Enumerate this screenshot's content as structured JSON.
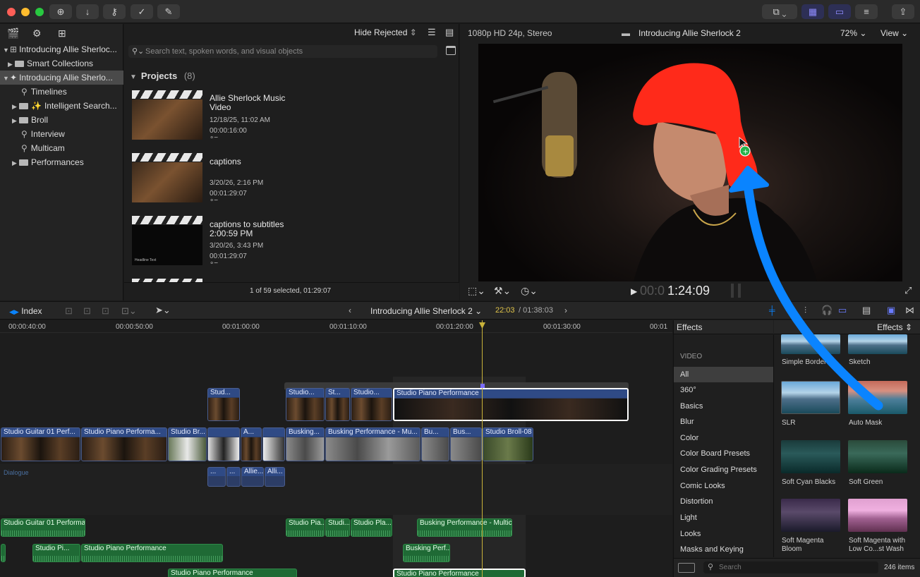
{
  "titlebar": {
    "buttons": [
      "plus-circle-icon",
      "download-icon",
      "key-icon",
      "check-circle-icon",
      "edit-icon"
    ]
  },
  "libraries": {
    "items": [
      {
        "label": "Introducing Allie Sherloc...",
        "depth": 0,
        "expanded": true
      },
      {
        "label": "Smart Collections",
        "depth": 1,
        "expanded": false
      },
      {
        "label": "Introducing Allie Sherlo...",
        "depth": 0,
        "expanded": true,
        "selected": true
      },
      {
        "label": "Timelines",
        "depth": 2,
        "kind": "smart"
      },
      {
        "label": "Intelligent Search...",
        "depth": 1,
        "expanded": false,
        "kind": "sparkle"
      },
      {
        "label": "Broll",
        "depth": 1,
        "expanded": false
      },
      {
        "label": "Interview",
        "depth": 2,
        "kind": "smart"
      },
      {
        "label": "Multicam",
        "depth": 2,
        "kind": "smart"
      },
      {
        "label": "Performances",
        "depth": 1,
        "expanded": false
      }
    ]
  },
  "browser": {
    "filter_label": "Hide Rejected",
    "search_placeholder": "Search text, spoken words, and visual objects",
    "section_title": "Projects",
    "section_count": "(8)",
    "projects": [
      {
        "title": "Allie Sherlock Music Video",
        "date": "12/18/25, 11:02 AM",
        "duration": "00:00:16:00",
        "keys": "∘−"
      },
      {
        "title": "captions",
        "date": "3/20/26, 2:16 PM",
        "duration": "00:01:29:07",
        "keys": "∘−"
      },
      {
        "title": "captions to subtitles 2:00:59 PM",
        "date": "3/20/26, 3:43 PM",
        "duration": "00:01:29:07",
        "keys": "∘−",
        "thumb_text": "Headline Text"
      }
    ],
    "status": "1 of 59 selected, 01:29:07"
  },
  "viewer": {
    "format": "1080p HD 24p, Stereo",
    "title": "Introducing Allie Sherlock 2",
    "zoom": "72%",
    "view_label": "View",
    "timecode_dim": "00:0",
    "timecode": "1:24:09"
  },
  "timeline_toolbar": {
    "index_label": "Index",
    "project_title": "Introducing Allie Sherlock 2",
    "position": "22:03",
    "duration": "/ 01:38:03"
  },
  "timeline": {
    "ruler": [
      "00:00:40:00",
      "00:00:50:00",
      "00:01:00:00",
      "00:01:10:00",
      "00:01:20:00",
      "00:01:30:00",
      "00:01"
    ],
    "dialogue_label": "Dialogue",
    "connected_clips": [
      "Stud...",
      "Studio...",
      "St...",
      "Studio...",
      "Studio Piano Performance"
    ],
    "primary_clips": [
      "Studio Guitar 01 Perf...",
      "Studio Piano Performa...",
      "Studio Br...",
      "A...",
      "Busking...",
      "Busking Performance - Mu...",
      "Bu...",
      "Bus...",
      "Studio Broll-08"
    ],
    "dialogue_clips": [
      "...",
      "...",
      "Allie...",
      "Alli..."
    ],
    "audio_clips": [
      "Studio Guitar 01 Performa...",
      "Studio Pia...",
      "Studi...",
      "Studio Pla...",
      "Busking Performance - Multic...",
      "Studio Pi...",
      "Studio Piano Performance",
      "Busking Perf...",
      "Studio Piano Performance",
      "Studio Piano Performance"
    ]
  },
  "effects": {
    "header_left": "Effects",
    "header_right": "Effects",
    "section": "VIDEO",
    "categories": [
      "All",
      "360°",
      "Basics",
      "Blur",
      "Color",
      "Color Board Presets",
      "Color Grading Presets",
      "Comic Looks",
      "Distortion",
      "Light",
      "Looks",
      "Masks and Keying"
    ],
    "items": [
      "Simple Border",
      "Sketch",
      "SLR",
      "Auto Mask",
      "Soft Cyan Blacks",
      "Soft Green",
      "Soft Magenta Bloom",
      "Soft Magenta with Low Co...st Wash"
    ],
    "search_placeholder": "Search",
    "count": "246 items"
  },
  "colors": {
    "accent": "#0a84ff",
    "mask_red": "#ff2a1a",
    "playhead": "#c9b23a",
    "video_clip": "#2c3d66",
    "audio_clip": "#1f6a35"
  }
}
